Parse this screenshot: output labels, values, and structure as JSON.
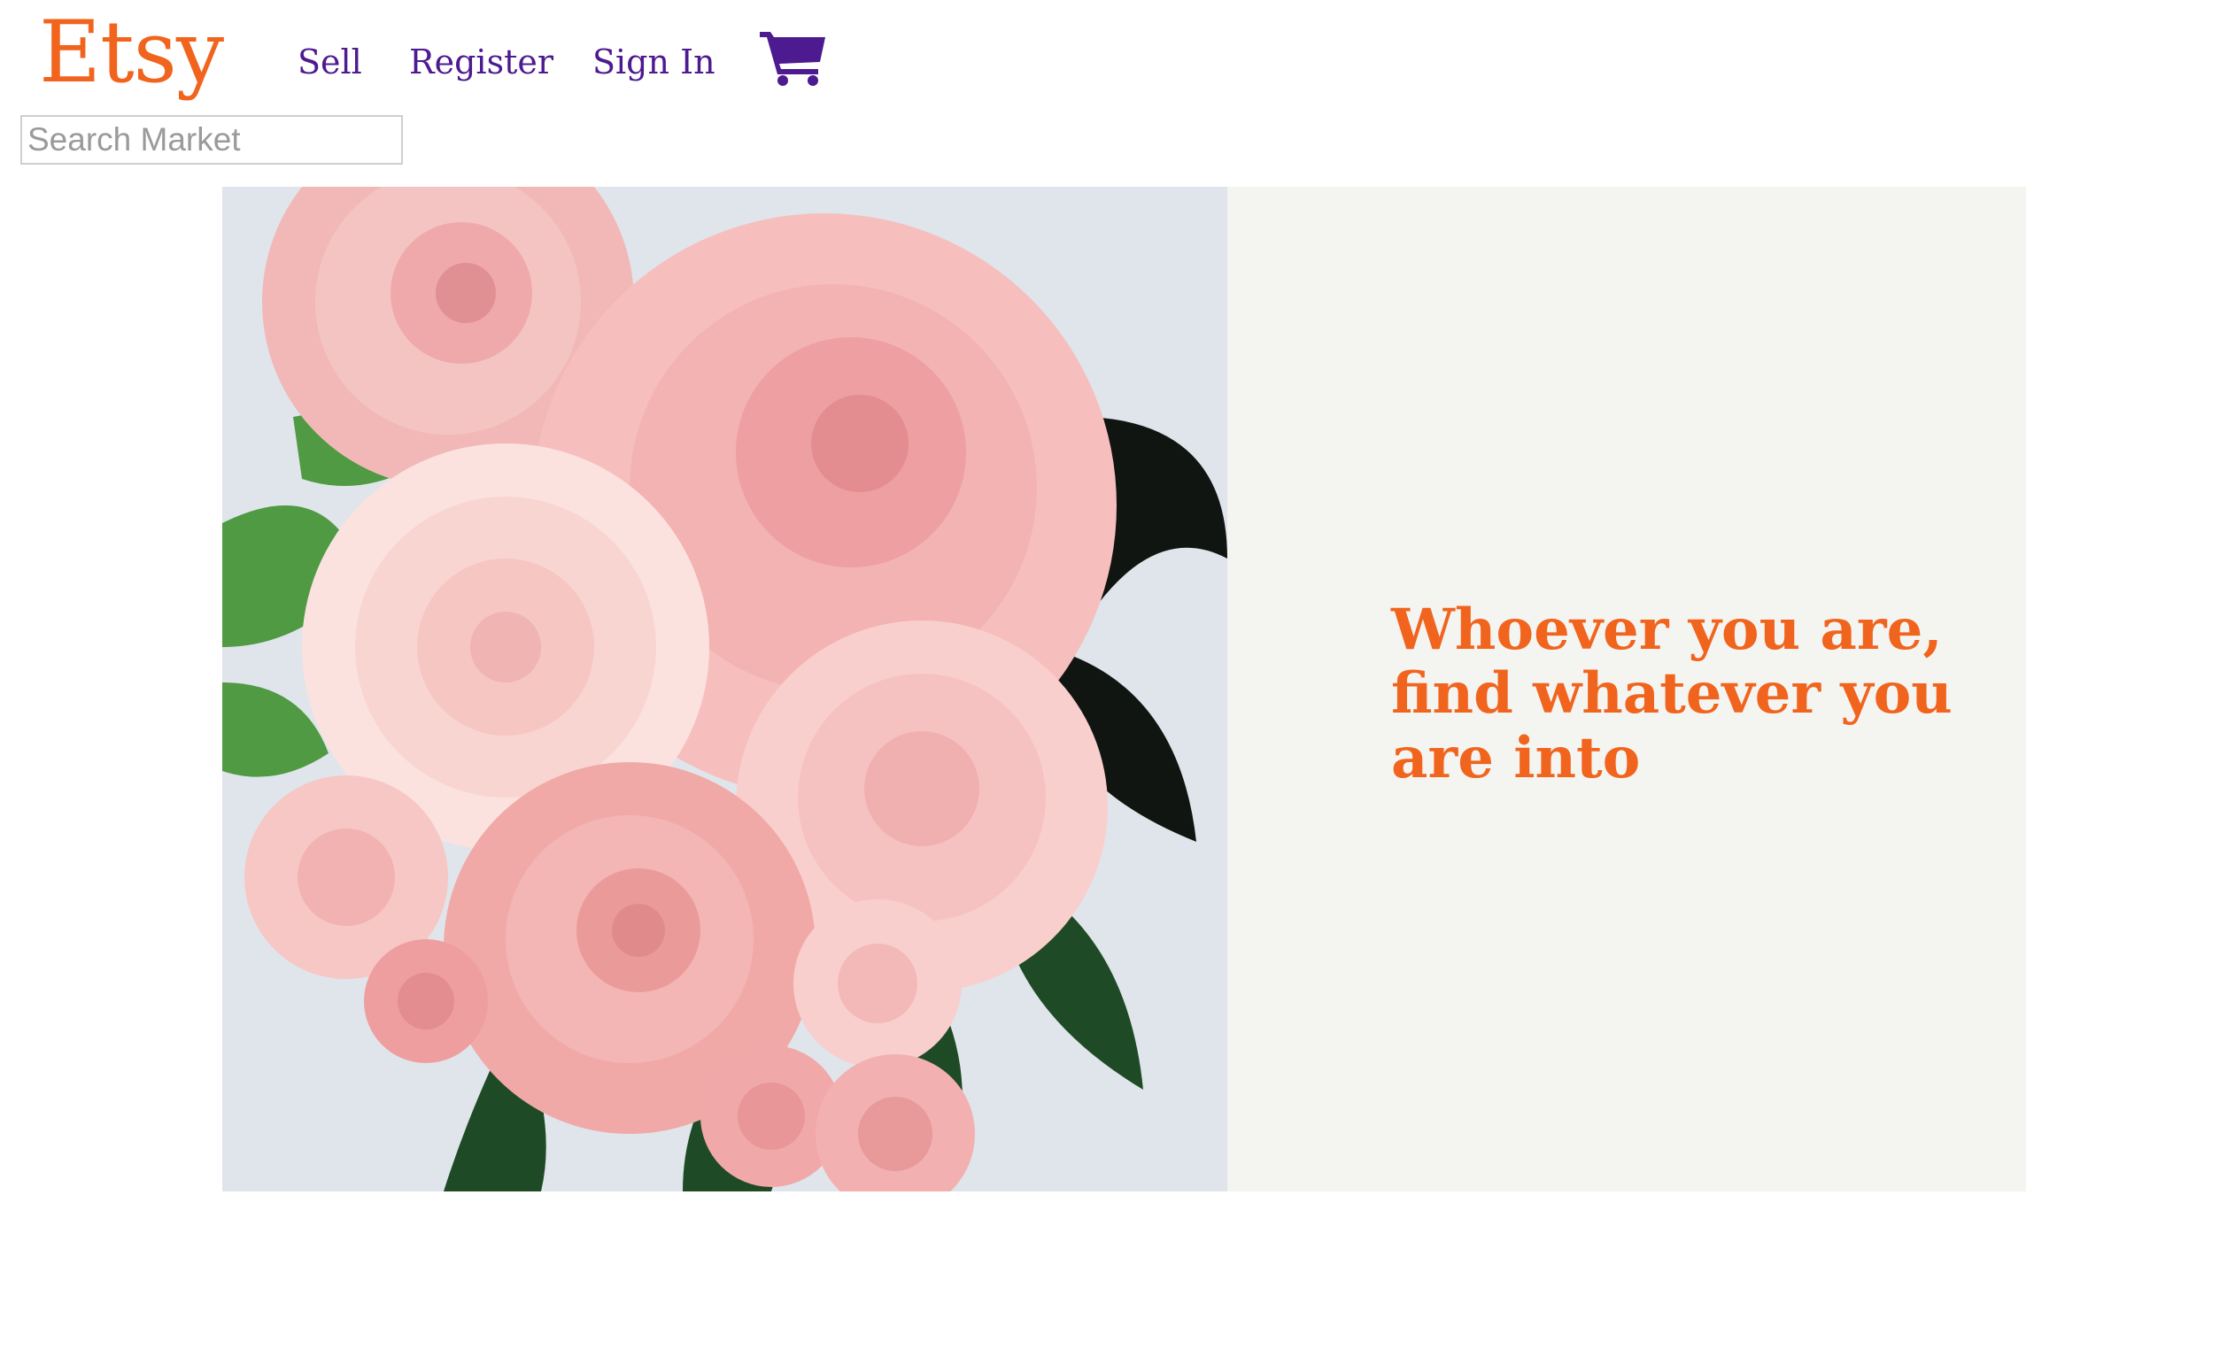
{
  "header": {
    "logo": "Etsy",
    "nav": {
      "sell": "Sell",
      "register": "Register",
      "sign_in": "Sign In"
    },
    "cart_icon": "shopping-cart-icon",
    "search": {
      "placeholder": "Search Market",
      "value": ""
    }
  },
  "hero": {
    "image_subject": "pink paper flowers with green leaves",
    "tagline": "Whoever you are, find whatever you are into"
  },
  "colors": {
    "brand_orange": "#f1641e",
    "nav_purple": "#4d1a8f",
    "panel_bg": "#f4f4f1"
  }
}
